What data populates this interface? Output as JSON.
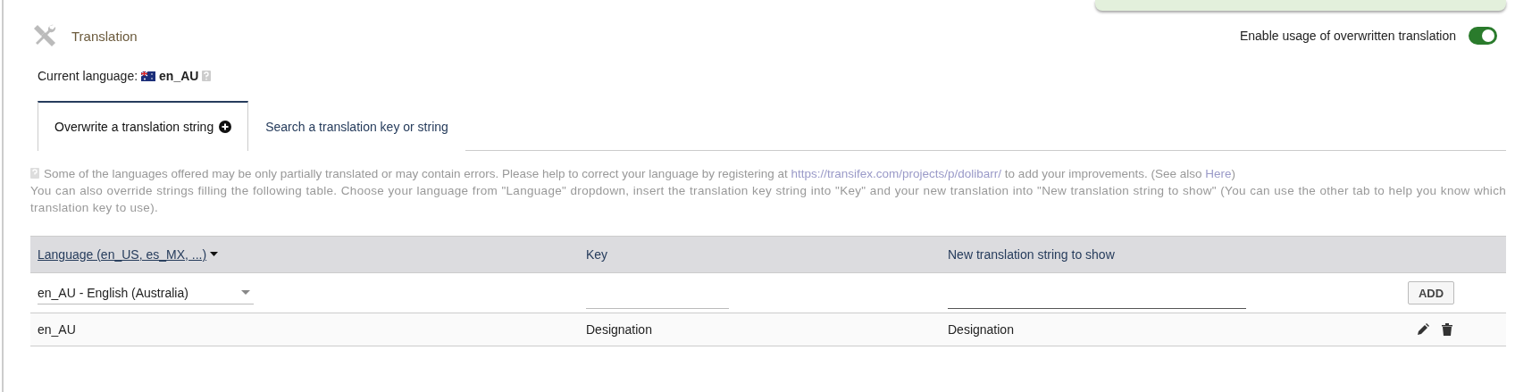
{
  "header": {
    "title": "Translation",
    "toggle": {
      "label": "Enable usage of overwritten translation",
      "on": true
    }
  },
  "current_language": {
    "label": "Current language:",
    "value": "en_AU"
  },
  "tabs": [
    {
      "label": "Overwrite a translation string",
      "selected": true
    },
    {
      "label": "Search a translation key or string",
      "selected": false
    }
  ],
  "note": {
    "line_1": [
      {
        "kind": "text",
        "text": "Some of the languages offered may be only partially translated or may contain errors. Please help to correct your language by registering at"
      },
      {
        "kind": "link",
        "text": "https://transifex.com/projects/p/dolibarr/"
      },
      {
        "kind": "text",
        "text": "to add your improvements. (See also"
      },
      {
        "kind": "link",
        "text": "Here"
      },
      {
        "kind": "text",
        "text": ")"
      }
    ],
    "line_2": "You can also override strings filling the following table. Choose your language from \"Language\" dropdown, insert the translation key string into \"Key\" and your new translation into \"New translation string to show\" (You can use the other tab to help you know which translation key to use)."
  },
  "table": {
    "columns": [
      {
        "label": "Language (en_US, es_MX, ...)",
        "sortable": true
      },
      {
        "label": "Key",
        "sortable": false
      },
      {
        "label": "New translation string to show",
        "sortable": false
      }
    ],
    "input_row": {
      "language": "en_AU - English (Australia)",
      "add_button": "ADD"
    },
    "rows": [
      {
        "language": "en_AU",
        "key": "Designation",
        "translation": "Designation"
      }
    ]
  }
}
